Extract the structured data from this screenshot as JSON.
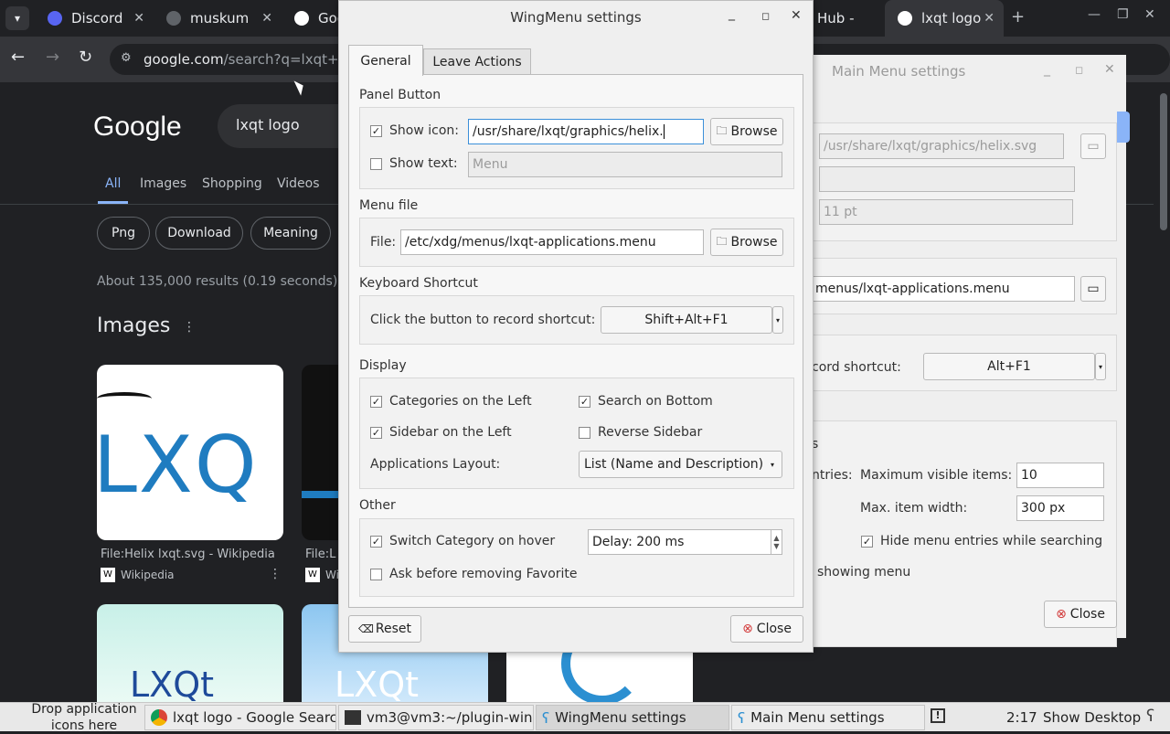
{
  "browser": {
    "tabs": [
      {
        "label": "Discord"
      },
      {
        "label": "muskum"
      },
      {
        "label": "Goo"
      },
      {
        "label": "Hub -"
      },
      {
        "label": "lxqt logo"
      }
    ],
    "url_host": "google.com",
    "url_path": "/search?q=lxqt+logo"
  },
  "google": {
    "logo": "Google",
    "query": "lxqt logo",
    "tabs": [
      "All",
      "Images",
      "Shopping",
      "Videos"
    ],
    "chips": [
      "Png",
      "Download",
      "Meaning"
    ],
    "results_stats": "About 135,000 results (0.19 seconds)",
    "images_heading": "Images",
    "image_results": [
      {
        "caption": "File:Helix lxqt.svg - Wikipedia",
        "source": "Wikipedia",
        "thumb_text": "LXQ"
      },
      {
        "caption": "File:L",
        "source": "Wi",
        "thumb_text": ""
      }
    ],
    "lower_thumbs": [
      "LXQt",
      "LXQt"
    ]
  },
  "main_menu": {
    "title": "Main Menu settings",
    "icon_path": "/usr/share/lxqt/graphics/helix.svg",
    "font_size": "11 pt",
    "menu_file": "menus/lxqt-applications.menu",
    "shortcut_label": "cord shortcut:",
    "shortcut": "Alt+F1",
    "s_tail": "s",
    "entries_label": "ntries:",
    "max_visible_label": "Maximum visible items:",
    "max_visible": "10",
    "max_width_label": "Max. item width:",
    "max_width": "300 px",
    "hide_entries": "Hide menu entries while searching",
    "showing_menu": "showing menu",
    "close": "Close"
  },
  "wingmenu": {
    "title": "WingMenu settings",
    "tabs": [
      "General",
      "Leave Actions"
    ],
    "panel_button": {
      "heading": "Panel Button",
      "show_icon": "Show icon:",
      "icon_path": "/usr/share/lxqt/graphics/helix.",
      "browse": "Browse",
      "show_text": "Show text:",
      "text_placeholder": "Menu"
    },
    "menu_file": {
      "heading": "Menu file",
      "file_label": "File:",
      "file_path": "/etc/xdg/menus/lxqt-applications.menu",
      "browse": "Browse"
    },
    "shortcut": {
      "heading": "Keyboard Shortcut",
      "label": "Click the button to record shortcut:",
      "value": "Shift+Alt+F1"
    },
    "display": {
      "heading": "Display",
      "categories_left": "Categories on the Left",
      "search_bottom": "Search on Bottom",
      "sidebar_left": "Sidebar on the Left",
      "reverse_sidebar": "Reverse Sidebar",
      "layout_label": "Applications Layout:",
      "layout_value": "List (Name and Description)"
    },
    "other": {
      "heading": "Other",
      "switch_hover": "Switch Category on hover",
      "delay": "Delay: 200 ms",
      "ask_remove": "Ask before removing Favorite"
    },
    "reset": "Reset",
    "close": "Close"
  },
  "taskbar": {
    "drop_hint": "Drop application icons here",
    "items": [
      "lxqt logo - Google Searc...",
      "vm3@vm3:~/plugin-wing...",
      "WingMenu settings",
      "Main Menu settings"
    ],
    "clock": "2:17",
    "show_desktop": "Show Desktop"
  }
}
